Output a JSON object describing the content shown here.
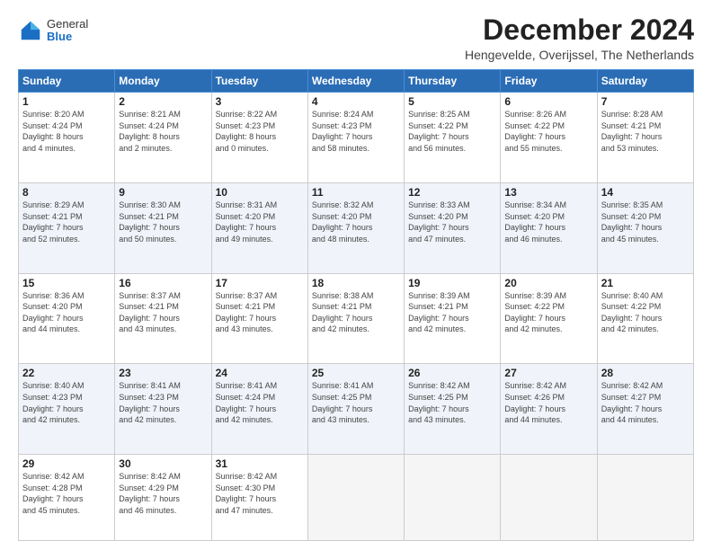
{
  "logo": {
    "general": "General",
    "blue": "Blue"
  },
  "title": "December 2024",
  "subtitle": "Hengevelde, Overijssel, The Netherlands",
  "days_header": [
    "Sunday",
    "Monday",
    "Tuesday",
    "Wednesday",
    "Thursday",
    "Friday",
    "Saturday"
  ],
  "weeks": [
    [
      {
        "day": "1",
        "info": "Sunrise: 8:20 AM\nSunset: 4:24 PM\nDaylight: 8 hours\nand 4 minutes."
      },
      {
        "day": "2",
        "info": "Sunrise: 8:21 AM\nSunset: 4:24 PM\nDaylight: 8 hours\nand 2 minutes."
      },
      {
        "day": "3",
        "info": "Sunrise: 8:22 AM\nSunset: 4:23 PM\nDaylight: 8 hours\nand 0 minutes."
      },
      {
        "day": "4",
        "info": "Sunrise: 8:24 AM\nSunset: 4:23 PM\nDaylight: 7 hours\nand 58 minutes."
      },
      {
        "day": "5",
        "info": "Sunrise: 8:25 AM\nSunset: 4:22 PM\nDaylight: 7 hours\nand 56 minutes."
      },
      {
        "day": "6",
        "info": "Sunrise: 8:26 AM\nSunset: 4:22 PM\nDaylight: 7 hours\nand 55 minutes."
      },
      {
        "day": "7",
        "info": "Sunrise: 8:28 AM\nSunset: 4:21 PM\nDaylight: 7 hours\nand 53 minutes."
      }
    ],
    [
      {
        "day": "8",
        "info": "Sunrise: 8:29 AM\nSunset: 4:21 PM\nDaylight: 7 hours\nand 52 minutes."
      },
      {
        "day": "9",
        "info": "Sunrise: 8:30 AM\nSunset: 4:21 PM\nDaylight: 7 hours\nand 50 minutes."
      },
      {
        "day": "10",
        "info": "Sunrise: 8:31 AM\nSunset: 4:20 PM\nDaylight: 7 hours\nand 49 minutes."
      },
      {
        "day": "11",
        "info": "Sunrise: 8:32 AM\nSunset: 4:20 PM\nDaylight: 7 hours\nand 48 minutes."
      },
      {
        "day": "12",
        "info": "Sunrise: 8:33 AM\nSunset: 4:20 PM\nDaylight: 7 hours\nand 47 minutes."
      },
      {
        "day": "13",
        "info": "Sunrise: 8:34 AM\nSunset: 4:20 PM\nDaylight: 7 hours\nand 46 minutes."
      },
      {
        "day": "14",
        "info": "Sunrise: 8:35 AM\nSunset: 4:20 PM\nDaylight: 7 hours\nand 45 minutes."
      }
    ],
    [
      {
        "day": "15",
        "info": "Sunrise: 8:36 AM\nSunset: 4:20 PM\nDaylight: 7 hours\nand 44 minutes."
      },
      {
        "day": "16",
        "info": "Sunrise: 8:37 AM\nSunset: 4:21 PM\nDaylight: 7 hours\nand 43 minutes."
      },
      {
        "day": "17",
        "info": "Sunrise: 8:37 AM\nSunset: 4:21 PM\nDaylight: 7 hours\nand 43 minutes."
      },
      {
        "day": "18",
        "info": "Sunrise: 8:38 AM\nSunset: 4:21 PM\nDaylight: 7 hours\nand 42 minutes."
      },
      {
        "day": "19",
        "info": "Sunrise: 8:39 AM\nSunset: 4:21 PM\nDaylight: 7 hours\nand 42 minutes."
      },
      {
        "day": "20",
        "info": "Sunrise: 8:39 AM\nSunset: 4:22 PM\nDaylight: 7 hours\nand 42 minutes."
      },
      {
        "day": "21",
        "info": "Sunrise: 8:40 AM\nSunset: 4:22 PM\nDaylight: 7 hours\nand 42 minutes."
      }
    ],
    [
      {
        "day": "22",
        "info": "Sunrise: 8:40 AM\nSunset: 4:23 PM\nDaylight: 7 hours\nand 42 minutes."
      },
      {
        "day": "23",
        "info": "Sunrise: 8:41 AM\nSunset: 4:23 PM\nDaylight: 7 hours\nand 42 minutes."
      },
      {
        "day": "24",
        "info": "Sunrise: 8:41 AM\nSunset: 4:24 PM\nDaylight: 7 hours\nand 42 minutes."
      },
      {
        "day": "25",
        "info": "Sunrise: 8:41 AM\nSunset: 4:25 PM\nDaylight: 7 hours\nand 43 minutes."
      },
      {
        "day": "26",
        "info": "Sunrise: 8:42 AM\nSunset: 4:25 PM\nDaylight: 7 hours\nand 43 minutes."
      },
      {
        "day": "27",
        "info": "Sunrise: 8:42 AM\nSunset: 4:26 PM\nDaylight: 7 hours\nand 44 minutes."
      },
      {
        "day": "28",
        "info": "Sunrise: 8:42 AM\nSunset: 4:27 PM\nDaylight: 7 hours\nand 44 minutes."
      }
    ],
    [
      {
        "day": "29",
        "info": "Sunrise: 8:42 AM\nSunset: 4:28 PM\nDaylight: 7 hours\nand 45 minutes."
      },
      {
        "day": "30",
        "info": "Sunrise: 8:42 AM\nSunset: 4:29 PM\nDaylight: 7 hours\nand 46 minutes."
      },
      {
        "day": "31",
        "info": "Sunrise: 8:42 AM\nSunset: 4:30 PM\nDaylight: 7 hours\nand 47 minutes."
      },
      {
        "day": "",
        "info": ""
      },
      {
        "day": "",
        "info": ""
      },
      {
        "day": "",
        "info": ""
      },
      {
        "day": "",
        "info": ""
      }
    ]
  ]
}
